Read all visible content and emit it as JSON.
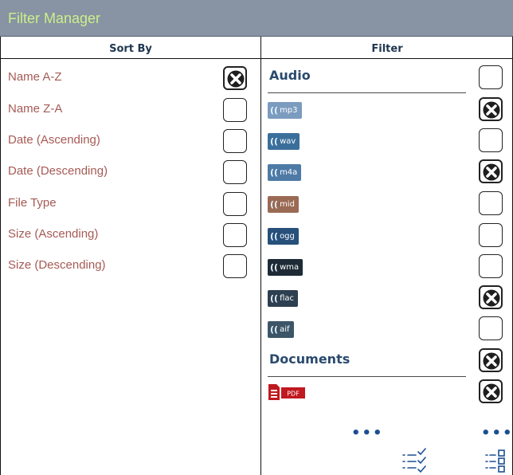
{
  "window": {
    "title": "Filter Manager"
  },
  "columns": {
    "sort_by": "Sort By",
    "filter": "Filter"
  },
  "sort_options": [
    {
      "label": "Name A-Z",
      "checked": true
    },
    {
      "label": "Name Z-A",
      "checked": false
    },
    {
      "label": "Date (Ascending)",
      "checked": false
    },
    {
      "label": "Date (Descending)",
      "checked": false
    },
    {
      "label": "File Type",
      "checked": false
    },
    {
      "label": "Size (Ascending)",
      "checked": false
    },
    {
      "label": "Size (Descending)",
      "checked": false
    }
  ],
  "filters": {
    "audio": {
      "label": "Audio",
      "checked": false,
      "items": [
        {
          "ext": "mp3",
          "icon": "audio-file-icon",
          "color": "#7b9bbf",
          "checked": true
        },
        {
          "ext": "wav",
          "icon": "audio-file-icon",
          "color": "#3b6f9b",
          "checked": false
        },
        {
          "ext": "m4a",
          "icon": "audio-file-icon",
          "color": "#4e7aa6",
          "checked": true
        },
        {
          "ext": "mid",
          "icon": "audio-file-icon",
          "color": "#9a6a54",
          "checked": false
        },
        {
          "ext": "ogg",
          "icon": "audio-file-icon",
          "color": "#27507a",
          "checked": false
        },
        {
          "ext": "wma",
          "icon": "audio-file-icon",
          "color": "#1e2b36",
          "checked": false
        },
        {
          "ext": "flac",
          "icon": "audio-file-icon",
          "color": "#2d3f50",
          "checked": true
        },
        {
          "ext": "aif",
          "icon": "audio-file-icon",
          "color": "#3c5668",
          "checked": false
        }
      ]
    },
    "documents": {
      "label": "Documents",
      "checked": true,
      "items": [
        {
          "ext": "PDF",
          "icon": "pdf-file-icon",
          "color": "#c0191f",
          "checked": true
        }
      ]
    }
  },
  "footer": {
    "more_icon": "more-dots-icon",
    "check_list_icon": "checklist-icon",
    "list_grid_icon": "list-grid-icon"
  }
}
